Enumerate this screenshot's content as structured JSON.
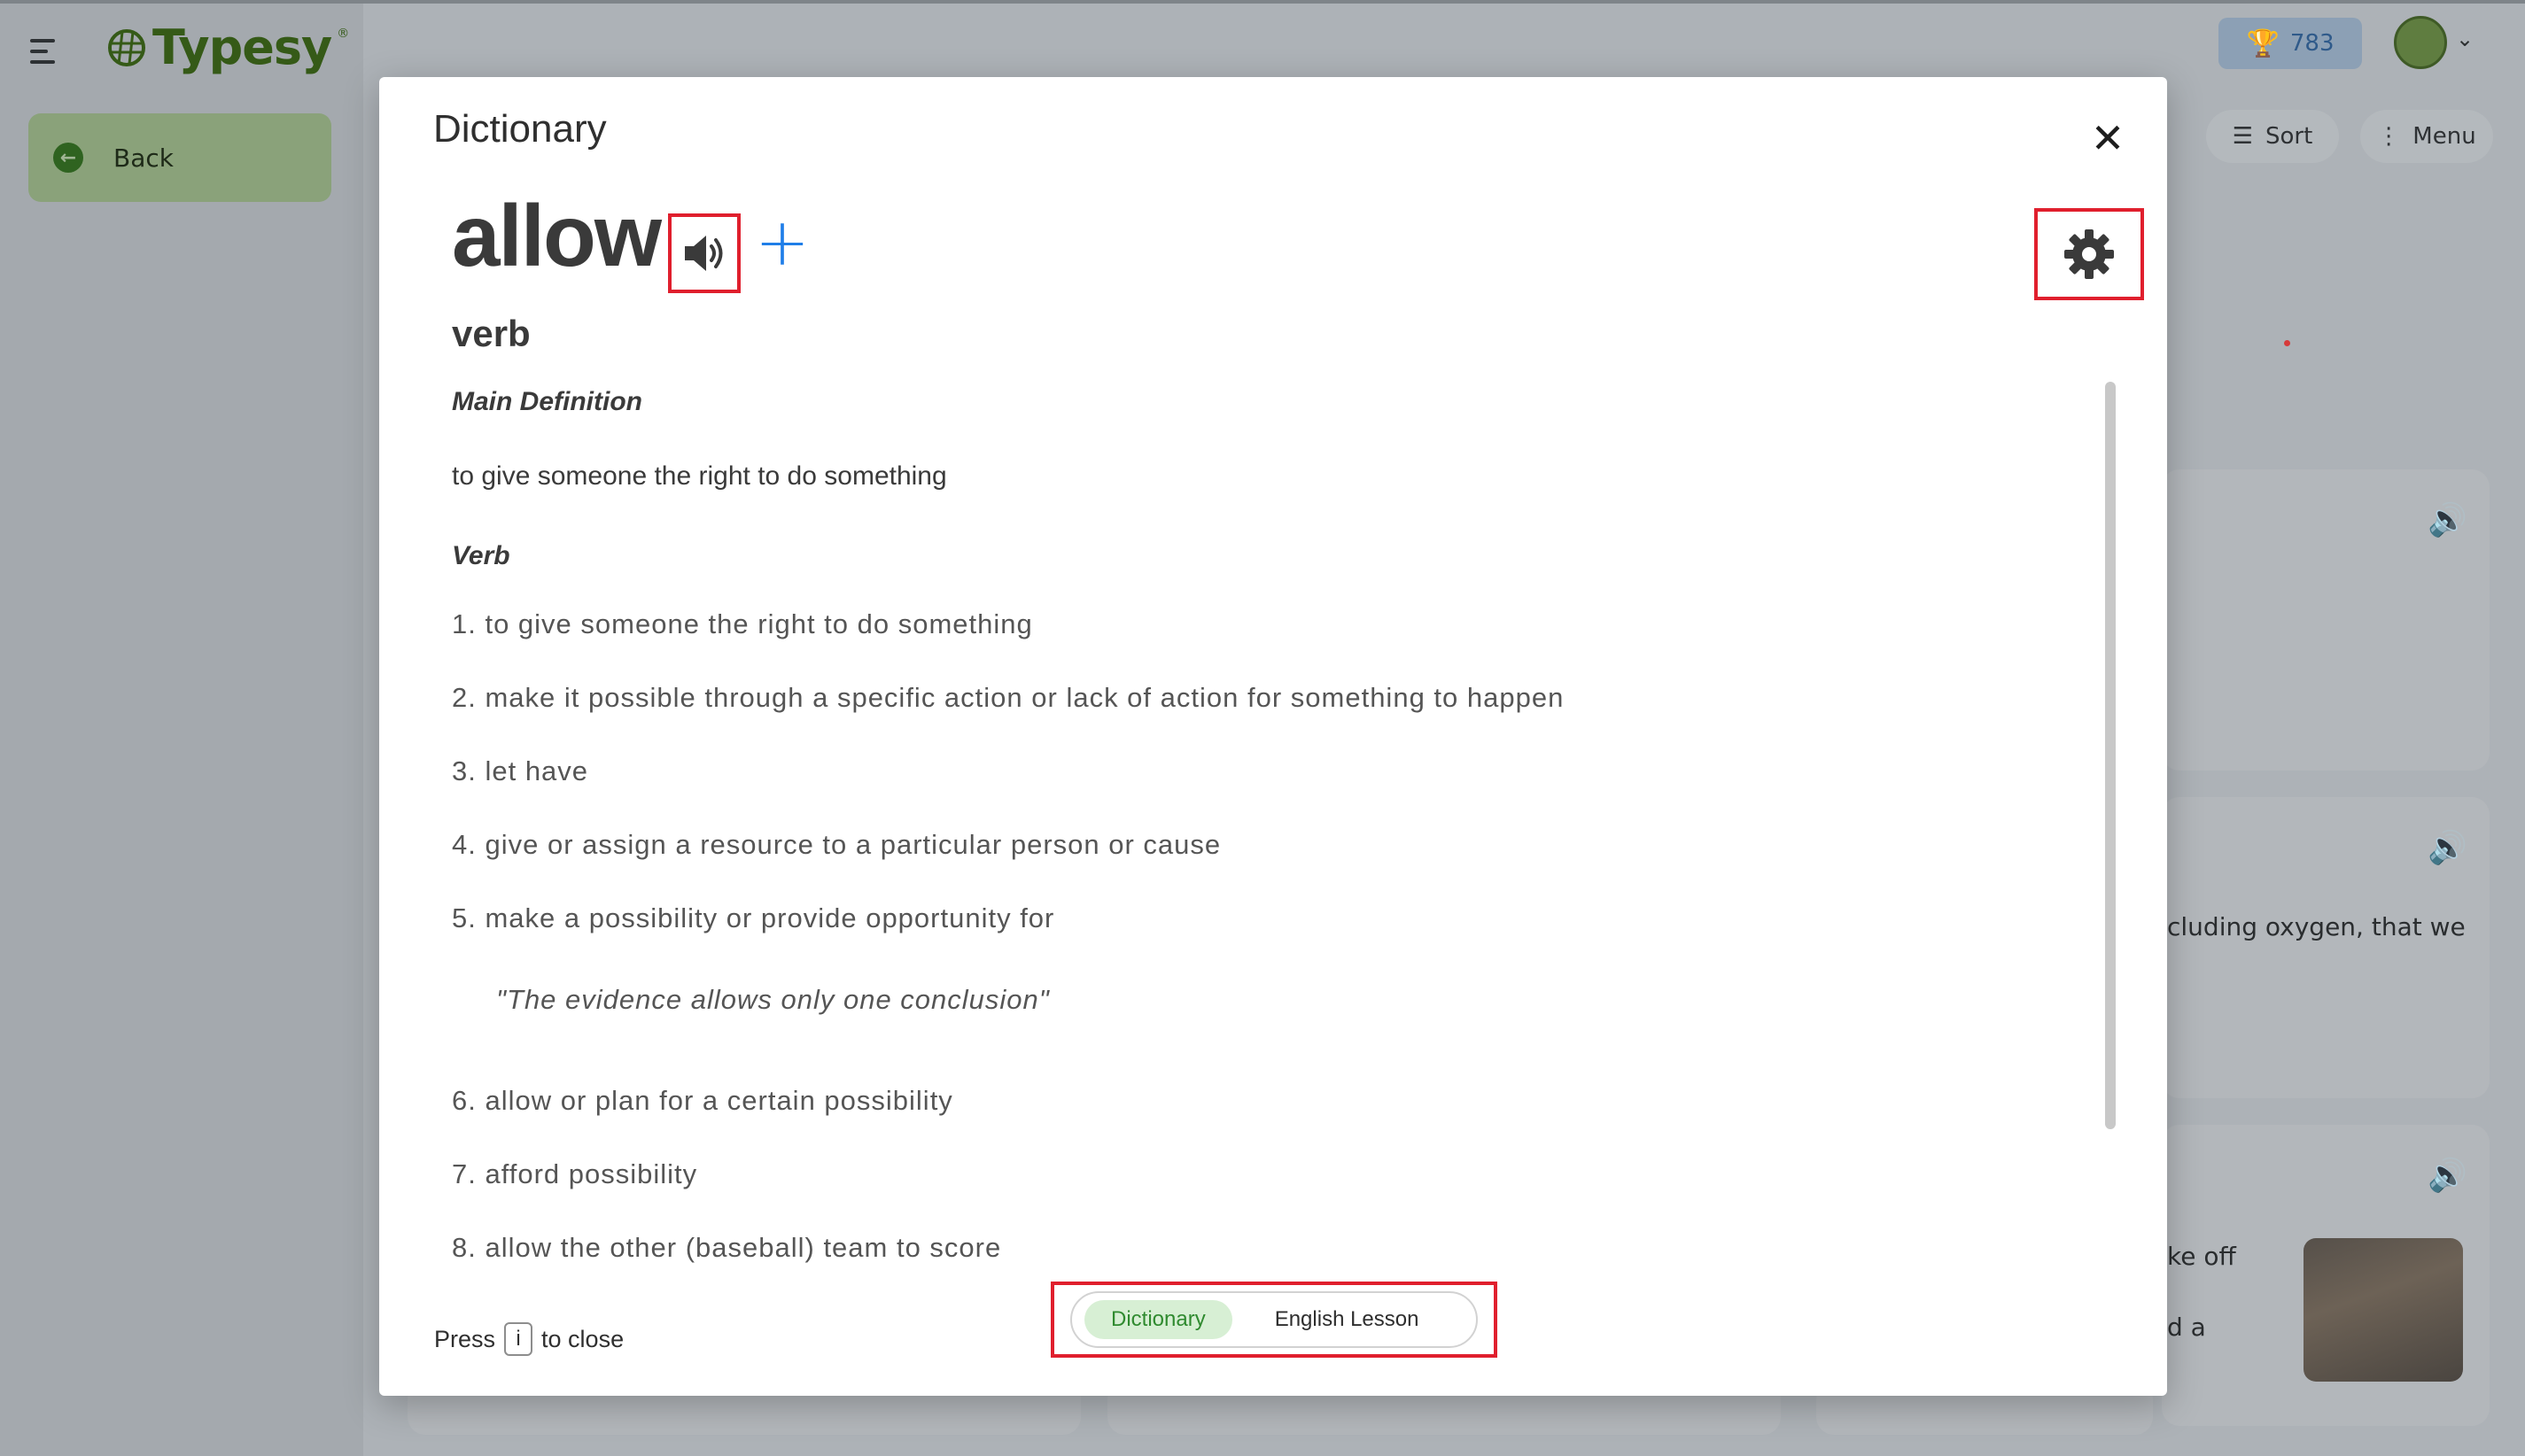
{
  "app": {
    "brand": "Typesy",
    "brand_mark": "®",
    "back_label": "Back",
    "points": "783",
    "sort_label": "Sort",
    "menu_label": "Menu",
    "bg_texts": [
      "cluding oxygen, that we",
      "ke off",
      "d a"
    ]
  },
  "dictionary": {
    "title": "Dictionary",
    "word": "allow",
    "add_symbol": "+",
    "part_of_speech": "verb",
    "main_definition_heading": "Main Definition",
    "main_definition": "to give someone the right to do something",
    "verb_heading": "Verb",
    "senses": [
      "1. to give someone the right to do something",
      "2. make it possible through a specific action or lack of action for something to happen",
      "3. let have",
      "4. give or assign a resource to a particular person or cause",
      "5. make a possibility or provide opportunity for"
    ],
    "example": "\"The evidence allows only one conclusion\"",
    "senses_after": [
      "6. allow or plan for a certain possibility",
      "7. afford possibility",
      "8. allow the other (baseball) team to score"
    ],
    "press_label": "Press",
    "key": "i",
    "close_hint": "to close",
    "tabs": [
      "Dictionary",
      "English Lesson"
    ],
    "active_tab": "Dictionary"
  },
  "colors": {
    "accent_red": "#e01f2d",
    "add_blue": "#1f7ee8",
    "active_tab_bg": "#d7efd4",
    "active_tab_text": "#2f8a2f"
  },
  "icons": [
    "hamburger-icon",
    "back-arrow-icon",
    "trophy-icon",
    "avatar-icon",
    "chevron-down-icon",
    "sort-icon",
    "menu-dots-icon",
    "speaker-icon",
    "plus-icon",
    "gear-icon",
    "close-icon"
  ]
}
